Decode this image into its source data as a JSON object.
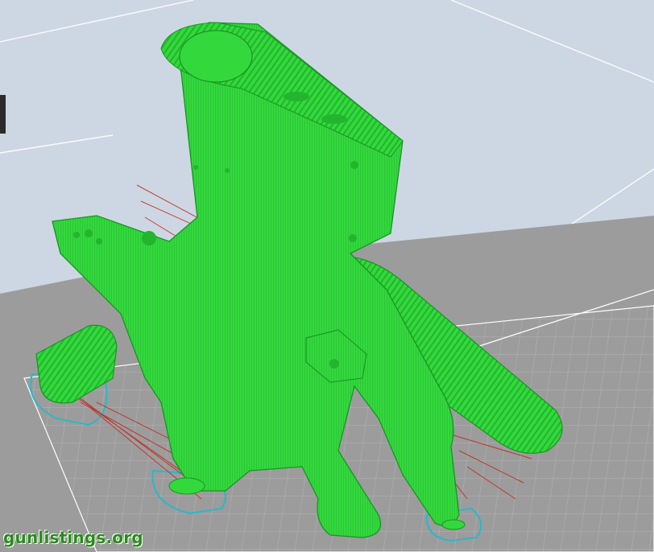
{
  "viewer": {
    "watermark_text": "gunlistings.org",
    "colors": {
      "background": "#c9d3df",
      "bed": "#9b9b9b",
      "bed_grid": "#b8b8b8",
      "model_green": "#2fd63a",
      "model_green_dark": "#1fa82a",
      "support_red": "#c0261a",
      "brim_outline": "#2cb7c9",
      "build_volume_line": "#ffffff"
    }
  }
}
